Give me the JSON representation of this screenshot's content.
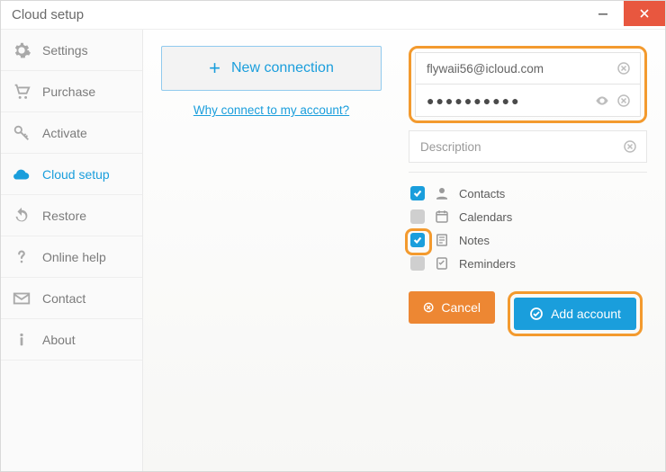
{
  "window": {
    "title": "Cloud setup"
  },
  "sidebar": {
    "items": [
      {
        "label": "Settings"
      },
      {
        "label": "Purchase"
      },
      {
        "label": "Activate"
      },
      {
        "label": "Cloud setup"
      },
      {
        "label": "Restore"
      },
      {
        "label": "Online help"
      },
      {
        "label": "Contact"
      },
      {
        "label": "About"
      }
    ],
    "active_index": 3
  },
  "main": {
    "new_connection_label": "New connection",
    "why_link": "Why connect to my account?"
  },
  "form": {
    "email": "flywaii56@icloud.com",
    "password_mask": "●●●●●●●●●●",
    "description_placeholder": "Description"
  },
  "sync_options": [
    {
      "label": "Contacts",
      "checked": true
    },
    {
      "label": "Calendars",
      "checked": false
    },
    {
      "label": "Notes",
      "checked": true
    },
    {
      "label": "Reminders",
      "checked": false
    }
  ],
  "buttons": {
    "cancel": "Cancel",
    "add": "Add account"
  },
  "colors": {
    "accent": "#1a9edc",
    "highlight": "#f39a2e",
    "cancel": "#ed8733"
  }
}
